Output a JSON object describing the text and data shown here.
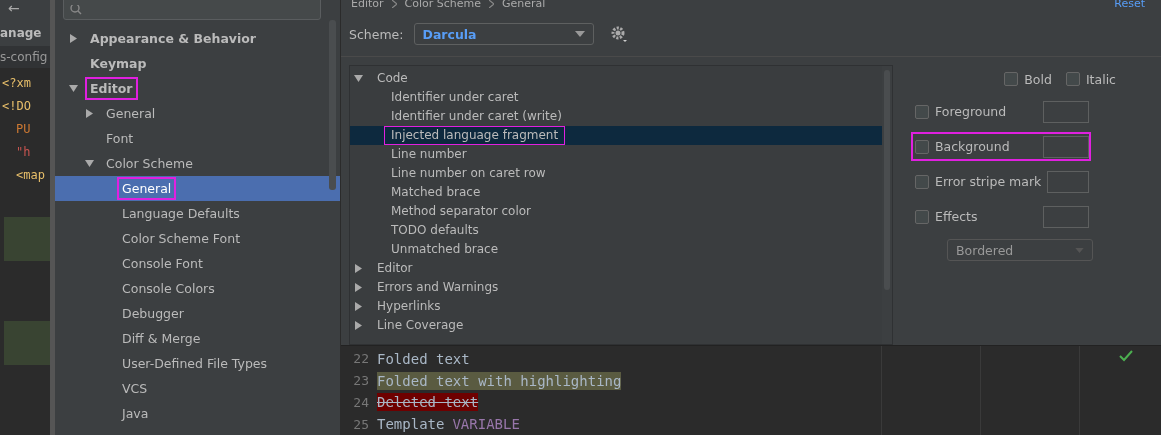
{
  "editor_strip": {
    "back": "←",
    "tab": "anage",
    "file": "s-config",
    "lines": [
      {
        "text": "<?xm",
        "kind": "tag"
      },
      {
        "text": "<!DO",
        "kind": "tag"
      },
      {
        "text": "PU",
        "kind": "keyword"
      },
      {
        "text": "\"h",
        "kind": "string"
      },
      {
        "text": "<map",
        "kind": "tag"
      }
    ]
  },
  "sidebar": {
    "items": [
      {
        "label": "Appearance & Behavior",
        "bold": true,
        "expanded": false,
        "selected": false,
        "boxed": false
      },
      {
        "label": "Keymap",
        "bold": true,
        "selected": false,
        "boxed": false
      },
      {
        "label": "Editor",
        "bold": true,
        "expanded": true,
        "selected": false,
        "boxed": true,
        "children": [
          {
            "label": "General",
            "expanded": false,
            "selected": false,
            "boxed": false
          },
          {
            "label": "Font",
            "selected": false,
            "boxed": false
          },
          {
            "label": "Color Scheme",
            "expanded": true,
            "selected": false,
            "boxed": false,
            "children": [
              {
                "label": "General",
                "selected": true,
                "boxed": true
              },
              {
                "label": "Language Defaults",
                "selected": false,
                "boxed": false
              },
              {
                "label": "Color Scheme Font",
                "selected": false,
                "boxed": false
              },
              {
                "label": "Console Font",
                "selected": false,
                "boxed": false
              },
              {
                "label": "Console Colors",
                "selected": false,
                "boxed": false
              },
              {
                "label": "Debugger",
                "selected": false,
                "boxed": false
              },
              {
                "label": "Diff & Merge",
                "selected": false,
                "boxed": false
              },
              {
                "label": "User-Defined File Types",
                "selected": false,
                "boxed": false
              },
              {
                "label": "VCS",
                "selected": false,
                "boxed": false
              },
              {
                "label": "Java",
                "selected": false,
                "boxed": false
              }
            ]
          }
        ]
      }
    ]
  },
  "breadcrumb": [
    "Editor",
    "Color Scheme",
    "General"
  ],
  "reset": "Reset",
  "scheme": {
    "label": "Scheme:",
    "value": "Darcula"
  },
  "attributes": [
    {
      "label": "Code",
      "expanded": true,
      "selected": false,
      "boxed": false,
      "children": [
        {
          "label": "Identifier under caret",
          "selected": false,
          "boxed": false
        },
        {
          "label": "Identifier under caret (write)",
          "selected": false,
          "boxed": false
        },
        {
          "label": "Injected language fragment",
          "selected": true,
          "boxed": true
        },
        {
          "label": "Line number",
          "selected": false,
          "boxed": false
        },
        {
          "label": "Line number on caret row",
          "selected": false,
          "boxed": false
        },
        {
          "label": "Matched brace",
          "selected": false,
          "boxed": false
        },
        {
          "label": "Method separator color",
          "selected": false,
          "boxed": false
        },
        {
          "label": "TODO defaults",
          "selected": false,
          "boxed": false
        },
        {
          "label": "Unmatched brace",
          "selected": false,
          "boxed": false
        }
      ]
    },
    {
      "label": "Editor",
      "expanded": false,
      "selected": false,
      "boxed": false
    },
    {
      "label": "Errors and Warnings",
      "expanded": false,
      "selected": false,
      "boxed": false
    },
    {
      "label": "Hyperlinks",
      "expanded": false,
      "selected": false,
      "boxed": false
    },
    {
      "label": "Line Coverage",
      "expanded": false,
      "selected": false,
      "boxed": false
    }
  ],
  "options": {
    "styles": [
      {
        "label": "Bold",
        "checked": false
      },
      {
        "label": "Italic",
        "checked": false
      }
    ],
    "rows": [
      {
        "label": "Foreground",
        "checked": false,
        "boxed": false
      },
      {
        "label": "Background",
        "checked": false,
        "boxed": true
      },
      {
        "label": "Error stripe mark",
        "checked": false,
        "boxed": false
      },
      {
        "label": "Effects",
        "checked": false,
        "boxed": false
      }
    ],
    "effect_type": "Bordered"
  },
  "preview": [
    {
      "number": "22",
      "text": "Folded text",
      "kind": "folded"
    },
    {
      "number": "23",
      "text": "Folded text with highlighting",
      "kind": "highlighted"
    },
    {
      "number": "24",
      "text": "Deleted text",
      "kind": "deleted"
    },
    {
      "number": "25",
      "text": "Template",
      "variable": "VARIABLE",
      "kind": "template"
    }
  ]
}
